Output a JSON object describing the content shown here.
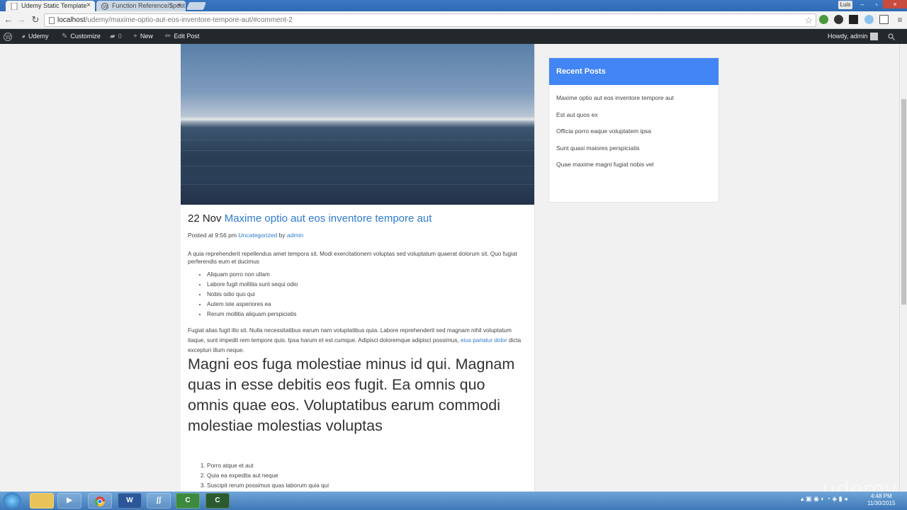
{
  "browser": {
    "tabs": [
      {
        "label": "Udemy Static Template",
        "active": true
      },
      {
        "label": "Function Reference/$post",
        "active": false
      }
    ],
    "url_host": "localhost",
    "url_path": "/udemy/maxime-optio-aut-eos-inventore-tempore-aut/#comment-2",
    "profile": "Luis"
  },
  "adminbar": {
    "site": "Udemy",
    "customize": "Customize",
    "comments": "0",
    "new": "New",
    "edit": "Edit Post",
    "howdy": "Howdy, admin"
  },
  "post": {
    "date": "22 Nov",
    "title": "Maxime optio aut eos inventore tempore aut",
    "meta_prefix": "Posted at 9:56 pm",
    "category": "Uncategorized",
    "by": "by",
    "author": "admin",
    "intro": "A quia reprehenderit repellendus amet tempora sit. Modi exercitationem voluptas sed voluptatum quaerat dolorum sit. Quo fugiat perferendis eum et ducimus",
    "bullets": [
      "Aliquam porro non ullam",
      "Labore fugit mollitia sunt sequi odio",
      "Nobis odio quo qui",
      "Autem iste asperiores ea",
      "Rerum mollitia aliquam perspiciatis"
    ],
    "para2_before": "Fugiat alias fugit illo sit. Nulla necessitatibus earum nam voluptatibus quia. Labore reprehenderit sed magnam nihil voluptatum itaque, sunt impedit rem tempore quis. Ipsa harum et est cumque. Adipisci doloremque adipisci possimus,",
    "para2_link": "eius pariatur dolor",
    "para2_after": "dicta excepturi illum neque.",
    "heading": "Magni eos fuga molestiae minus id qui. Magnam quas in esse debitis eos fugit. Ea omnis quo omnis quae eos. Voluptatibus earum commodi molestiae molestias voluptas",
    "numbered": [
      "Porro atque et aut",
      "Quia ea expedita aut neque",
      "Suscipit rerum possimus quas laborum quia qui"
    ]
  },
  "sidebar": {
    "title": "Recent Posts",
    "posts": [
      "Maxime optio aut eos inventore tempore aut",
      "Est aut quos ex",
      "Officia porro eaque voluptatem ipsa",
      "Sunt quasi maiores perspiciatis",
      "Quae maxime magni fugiat nobis vel"
    ]
  },
  "taskbar": {
    "time": "4:48 PM",
    "date": "11/30/2015",
    "watermark": "udemy"
  },
  "colors": {
    "link": "#2e7bcf",
    "widget_header": "#4285f4",
    "adminbar": "#23282d"
  },
  "icons": [
    "wordpress-icon",
    "dashboard-icon",
    "brush-icon",
    "comment-icon",
    "plus-icon",
    "pencil-icon",
    "search-icon",
    "star-icon",
    "back-icon",
    "forward-icon",
    "reload-icon"
  ]
}
